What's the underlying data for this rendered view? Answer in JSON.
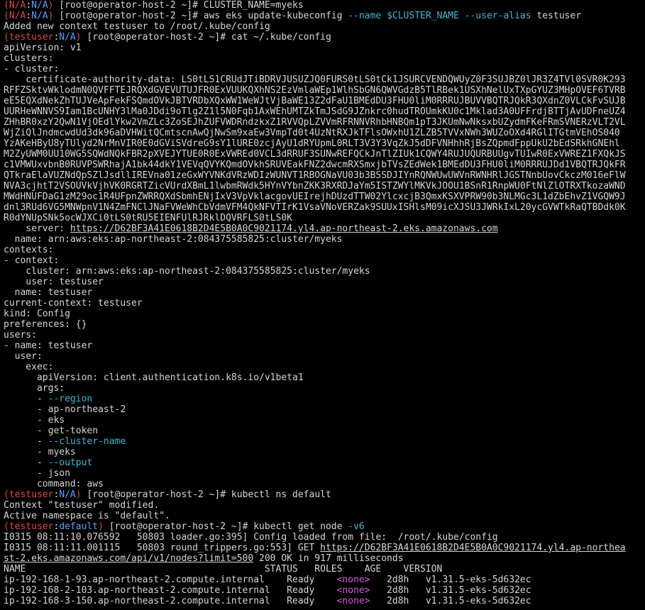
{
  "terminal": {
    "lines": [
      {
        "segments": [
          {
            "t": "(",
            "c": "red"
          },
          {
            "t": "N/A",
            "c": "red"
          },
          {
            "t": ":",
            "c": ""
          },
          {
            "t": "N/A",
            "c": "blue"
          },
          {
            "t": ")",
            "c": "red"
          },
          {
            "t": " [root@operator-host-2 ~]# CLUSTER_NAME=myeks",
            "c": ""
          }
        ]
      },
      {
        "segments": [
          {
            "t": "(",
            "c": "red"
          },
          {
            "t": "N/A",
            "c": "red"
          },
          {
            "t": ":",
            "c": ""
          },
          {
            "t": "N/A",
            "c": "blue"
          },
          {
            "t": ")",
            "c": "red"
          },
          {
            "t": " [root@operator-host-2 ~]# aws eks update-kubeconfig ",
            "c": ""
          },
          {
            "t": "--name",
            "c": "cyan"
          },
          {
            "t": " $CLUSTER_NAME ",
            "c": "cyan"
          },
          {
            "t": "--user-alias",
            "c": "cyan"
          },
          {
            "t": " testuser",
            "c": ""
          }
        ]
      },
      {
        "segments": [
          {
            "t": "Added new context testuser to /root/.kube/config",
            "c": ""
          }
        ]
      },
      {
        "segments": [
          {
            "t": "(",
            "c": "red"
          },
          {
            "t": "testuser",
            "c": "red"
          },
          {
            "t": ":",
            "c": ""
          },
          {
            "t": "N/A",
            "c": "blue"
          },
          {
            "t": ")",
            "c": "red"
          },
          {
            "t": " [root@operator-host-2 ~]# cat ~/.kube/config",
            "c": ""
          }
        ]
      },
      {
        "segments": [
          {
            "t": "apiVersion: v1",
            "c": ""
          }
        ]
      },
      {
        "segments": [
          {
            "t": "clusters:",
            "c": ""
          }
        ]
      },
      {
        "segments": [
          {
            "t": "- cluster:",
            "c": ""
          }
        ]
      },
      {
        "segments": [
          {
            "t": "    certificate-authority-data: LS0tLS1CRUdJTiBDRVJUSUZJQ0FURS0tLS0tCk1JSURCVENDQWUyZ0F3SUJBZ0lJR3Z4TVl0SVR0K293",
            "c": ""
          }
        ]
      },
      {
        "segments": [
          {
            "t": "RFFZSktvWklodmN0QVFFTEJRQXdGVEVUTUJFR0ExVUUKQXhNS2EzVmlaWEp1WlhSbGN6QWVGdzB5TlRBek1USXhNelUxTXpGYUZ3MHpOVEF6TVRB",
            "c": ""
          }
        ]
      },
      {
        "segments": [
          {
            "t": "eE5EQXdNekZhTUJVeApFekFSQmdOVkJBTVRDbXQxWW1WeWJtVjBaWE13Z2dFaU1BMEdDU3FHU0liM0RRRUJBUVVBQTRJQkR3QXdnZ0VLCkFvSUJB",
            "c": ""
          }
        ]
      },
      {
        "segments": [
          {
            "t": "UURHeWNNVS9Iam1BcUNHY3lMa0JDdi9oTlg2Z1l5N0Fqb1AxWEhUMTZkTmJSdG9JZnkrc0hudTROUmkKU0c1Mklad3A0UFFrdjBTTjAvUDFneUZ4",
            "c": ""
          }
        ]
      },
      {
        "segments": [
          {
            "t": "ZHhBR0xzY2QwN1VjOEdlYkw2VmZLc3ZoSEJhZUFVWDRndzkxZ1RVVQpLZVVmRFRNNVRhbHNBQm1pT3JKUmNwNksxbUZydmFKeFRmSVNERzVLT2VL",
            "c": ""
          }
        ]
      },
      {
        "segments": [
          {
            "t": "WjZiQlJndmcwdUd3dk96aDVHWitQCmtscnAwQjNwSm9xaEw3VmpTd0t4UzNtRXJkTFlsOWxhU1ZLZB5TVVxNWh3WUZoOXd4RGlITGtmVEhOS040",
            "c": ""
          }
        ]
      },
      {
        "segments": [
          {
            "t": "YzAKeHByU8yTUlyd2NrMnVIR0E0dGViSVdreG9sY1lURE0zcjAyU1dRYUpmL0RLT3V3Y3VqZkJ5dDFVNHhhRjBsZQpmdFppUkU2bEdSRkhGNEhl",
            "c": ""
          }
        ]
      },
      {
        "segments": [
          {
            "t": "M2ZyUWM0UU10WG5SQWdNQkFBR2pXVEJYTUE0R0ExVWREd0VCL3dRRUF3SUNwREFQCkJnTlZIUk1CQWY4RUJUQURBUUgvTUIwR0ExVWREZ1FXQkJS",
            "c": ""
          }
        ]
      },
      {
        "segments": [
          {
            "t": "c1VMWUxvbnB0RUVPSWRhajA1bk44dkY1VEVqQVYKQmdOVkhSRUVEakFNZ2dwcmRXSmxjbTVsZEdWek1BMEdDU3FHU0liM0RRRUJDd1VBQTRJQkFR",
            "c": ""
          }
        ]
      },
      {
        "segments": [
          {
            "t": "QTkraElaVUZNdQpSZlJsdllIREVna01zeGxWYVNKdVRzWDIzWUNVT1RBOGNaVU03b3BSSDJIYnRQNWUwUWVnRWNHRlJGSTNnbUovCkczM016eFlW",
            "c": ""
          }
        ]
      },
      {
        "segments": [
          {
            "t": "NVA3cjhtT2VSOUVkVjhVK0RGRTZicVUrdXBmL1lwbmRWdk5HYnVYbnZKK3RXRDJaYm5ISTZWYlMKVkJOOU1BSnR1RnpWU0FtNlZlOTRXTkozaWND",
            "c": ""
          }
        ]
      },
      {
        "segments": [
          {
            "t": "MWdHNUFDaG1zM29oc1R4UFpnZWRRQXdSbmhENjIxV3VpVklacgovUEIrejhDUzdTTW02YlcxcjB3QmxKSXVPRW90b3NLMGc3L1dZbEhvZ1VGQW9J",
            "c": ""
          }
        ]
      },
      {
        "segments": [
          {
            "t": "dnl3RUd6VG5MNWpnV1N4ZmFNClJNaFVWeWhCbVdmVFM4QkNFVTIrK1VsaVNoVERZak9SUUxISHlsM09icXJSU3JWRkIxL20ycGVWTkRaQTBDdk0K",
            "c": ""
          }
        ]
      },
      {
        "segments": [
          {
            "t": "R0dYNUpSNk5ocWJXCi0tLS0tRU5EIENFUlRJRklDQVRFLS0tLS0K",
            "c": ""
          }
        ]
      },
      {
        "segments": [
          {
            "t": "    server: ",
            "c": ""
          },
          {
            "t": "https://D62BF3A41E0618B2D4E5B0A0C9021174.yl4.ap-northeast-2.eks.amazonaws.com",
            "c": "link"
          }
        ]
      },
      {
        "segments": [
          {
            "t": "  name: arn:aws:eks:ap-northeast-2:084375585825:cluster/myeks",
            "c": ""
          }
        ]
      },
      {
        "segments": [
          {
            "t": "contexts:",
            "c": ""
          }
        ]
      },
      {
        "segments": [
          {
            "t": "- context:",
            "c": ""
          }
        ]
      },
      {
        "segments": [
          {
            "t": "    cluster: arn:aws:eks:ap-northeast-2:084375585825:cluster/myeks",
            "c": ""
          }
        ]
      },
      {
        "segments": [
          {
            "t": "    user: testuser",
            "c": ""
          }
        ]
      },
      {
        "segments": [
          {
            "t": "  name: testuser",
            "c": ""
          }
        ]
      },
      {
        "segments": [
          {
            "t": "current-context: testuser",
            "c": ""
          }
        ]
      },
      {
        "segments": [
          {
            "t": "kind: Config",
            "c": ""
          }
        ]
      },
      {
        "segments": [
          {
            "t": "preferences: {}",
            "c": ""
          }
        ]
      },
      {
        "segments": [
          {
            "t": "users:",
            "c": ""
          }
        ]
      },
      {
        "segments": [
          {
            "t": "- name: testuser",
            "c": ""
          }
        ]
      },
      {
        "segments": [
          {
            "t": "  user:",
            "c": ""
          }
        ]
      },
      {
        "segments": [
          {
            "t": "    exec:",
            "c": ""
          }
        ]
      },
      {
        "segments": [
          {
            "t": "      apiVersion: client.authentication.k8s.io/v1beta1",
            "c": ""
          }
        ]
      },
      {
        "segments": [
          {
            "t": "      args:",
            "c": ""
          }
        ]
      },
      {
        "segments": [
          {
            "t": "      - ",
            "c": ""
          },
          {
            "t": "--region",
            "c": "cyan"
          }
        ]
      },
      {
        "segments": [
          {
            "t": "      - ap-northeast-2",
            "c": ""
          }
        ]
      },
      {
        "segments": [
          {
            "t": "      - eks",
            "c": ""
          }
        ]
      },
      {
        "segments": [
          {
            "t": "      - get-token",
            "c": ""
          }
        ]
      },
      {
        "segments": [
          {
            "t": "      - ",
            "c": ""
          },
          {
            "t": "--cluster-name",
            "c": "cyan"
          }
        ]
      },
      {
        "segments": [
          {
            "t": "      - myeks",
            "c": ""
          }
        ]
      },
      {
        "segments": [
          {
            "t": "      - ",
            "c": ""
          },
          {
            "t": "--output",
            "c": "cyan"
          }
        ]
      },
      {
        "segments": [
          {
            "t": "      - json",
            "c": ""
          }
        ]
      },
      {
        "segments": [
          {
            "t": "      command: aws",
            "c": ""
          }
        ]
      },
      {
        "segments": [
          {
            "t": "(",
            "c": "red"
          },
          {
            "t": "testuser",
            "c": "red"
          },
          {
            "t": ":",
            "c": ""
          },
          {
            "t": "N/A",
            "c": "blue"
          },
          {
            "t": ")",
            "c": "red"
          },
          {
            "t": " [root@operator-host-2 ~]# kubectl ns default",
            "c": ""
          }
        ]
      },
      {
        "segments": [
          {
            "t": "Context \"testuser\" modified.",
            "c": ""
          }
        ]
      },
      {
        "segments": [
          {
            "t": "Active namespace is \"default\".",
            "c": ""
          }
        ]
      },
      {
        "segments": [
          {
            "t": "(",
            "c": "red"
          },
          {
            "t": "testuser",
            "c": "red"
          },
          {
            "t": ":",
            "c": ""
          },
          {
            "t": "default",
            "c": "blue"
          },
          {
            "t": ")",
            "c": "red"
          },
          {
            "t": " [root@operator-host-2 ~]# kubectl get node ",
            "c": ""
          },
          {
            "t": "-v6",
            "c": "cyan"
          }
        ]
      },
      {
        "segments": [
          {
            "t": "I0315 08:11:10.076592   50803 loader.go:395] Config loaded from file:  /root/.kube/config",
            "c": ""
          }
        ]
      },
      {
        "segments": [
          {
            "t": "I0315 08:11:11.001115   50803 round_trippers.go:553] GET ",
            "c": ""
          },
          {
            "t": "https://D62BF3A41E0618B2D4E5B0A0C9021174.yl4.ap-northea",
            "c": "link"
          }
        ]
      },
      {
        "segments": [
          {
            "t": "st-2.eks.amazonaws.com/api/v1/nodes?limit=500",
            "c": "link"
          },
          {
            "t": " 200 OK in 917 milliseconds",
            "c": ""
          }
        ]
      },
      {
        "segments": [
          {
            "t": "NAME                                           STATUS   ROLES    AGE    VERSION",
            "c": ""
          }
        ]
      },
      {
        "segments": [
          {
            "t": "ip-192-168-1-93.ap-northeast-2.compute.internal    Ready    ",
            "c": ""
          },
          {
            "t": "<none>",
            "c": "magenta"
          },
          {
            "t": "   2d8h   v1.31.5-eks-5d632ec",
            "c": ""
          }
        ]
      },
      {
        "segments": [
          {
            "t": "ip-192-168-2-103.ap-northeast-2.compute.internal   Ready    ",
            "c": ""
          },
          {
            "t": "<none>",
            "c": "magenta"
          },
          {
            "t": "   2d8h   v1.31.5-eks-5d632ec",
            "c": ""
          }
        ]
      },
      {
        "segments": [
          {
            "t": "ip-192-168-3-150.ap-northeast-2.compute.internal   Ready    ",
            "c": ""
          },
          {
            "t": "<none>",
            "c": "magenta"
          },
          {
            "t": "   2d8h   v1.31.5-eks-5d632ec",
            "c": ""
          }
        ]
      }
    ]
  }
}
